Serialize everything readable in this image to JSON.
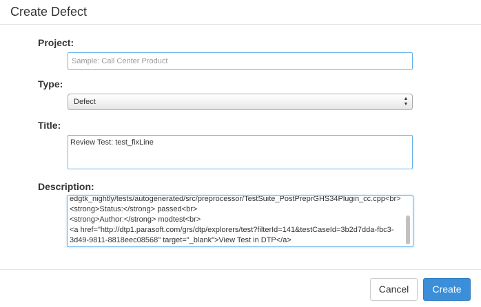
{
  "header": {
    "title": "Create Defect"
  },
  "form": {
    "project": {
      "label": "Project:",
      "value": "",
      "placeholder": "Sample: Call Center Product"
    },
    "type": {
      "label": "Type:",
      "selected": "Defect"
    },
    "title": {
      "label": "Title:",
      "value": "Review Test: test_fixLine"
    },
    "description": {
      "label": "Description:",
      "lines": [
        "edgtk_nightly/tests/autogenerated/src/preprocessor/TestSuite_PostPreprGHS34Plugin_cc.cpp<br>",
        "<strong>Status:</strong> passed<br>",
        "<strong>Author:</strong> modtest<br>",
        "<a href=\"http://dtp1.parasoft.com/grs/dtp/explorers/test?filterId=141&testCaseId=3b2d7dda-fbc3-",
        "3d49-9811-8818eec08568\" target=\"_blank\">View Test in DTP</a>"
      ]
    }
  },
  "footer": {
    "cancel_label": "Cancel",
    "create_label": "Create"
  },
  "colors": {
    "primary": "#3a8fd8",
    "focus_border": "#66afe9"
  }
}
